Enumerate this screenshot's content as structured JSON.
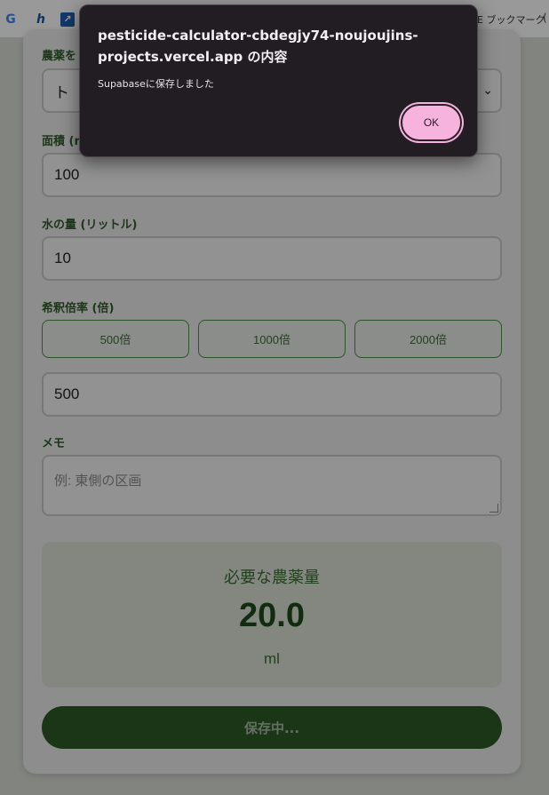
{
  "bookmarks": {
    "items": [
      {
        "icon": "google-icon",
        "glyph": "G"
      },
      {
        "icon": "h-logo-icon",
        "glyph": "h"
      },
      {
        "icon": "chart-app-icon",
        "glyph": "↗"
      }
    ],
    "line_bookmark_label": "E ブックマーク",
    "more_glyph": "("
  },
  "form": {
    "pesticide_label": "農薬を",
    "pesticide_value": "ト",
    "area_label": "面積 (r",
    "area_value": "100",
    "water_label": "水の量 (リットル)",
    "water_value": "10",
    "dilution_label": "希釈倍率 (倍)",
    "dilution_presets": [
      "500倍",
      "1000倍",
      "2000倍"
    ],
    "dilution_value": "500",
    "memo_label": "メモ",
    "memo_placeholder": "例: 東側の区画"
  },
  "result": {
    "title": "必要な農薬量",
    "value": "20.0",
    "unit": "ml"
  },
  "save_button": {
    "label": "保存中..."
  },
  "dialog": {
    "title": "pesticide-calculator-cbdegjy74-noujoujins-projects.vercel.app の内容",
    "message": "Supabaseに保存しました",
    "ok_label": "OK"
  },
  "colors": {
    "accent_green": "#2d5a27",
    "ok_button": "#f5b3de",
    "dialog_bg": "#221d22"
  }
}
